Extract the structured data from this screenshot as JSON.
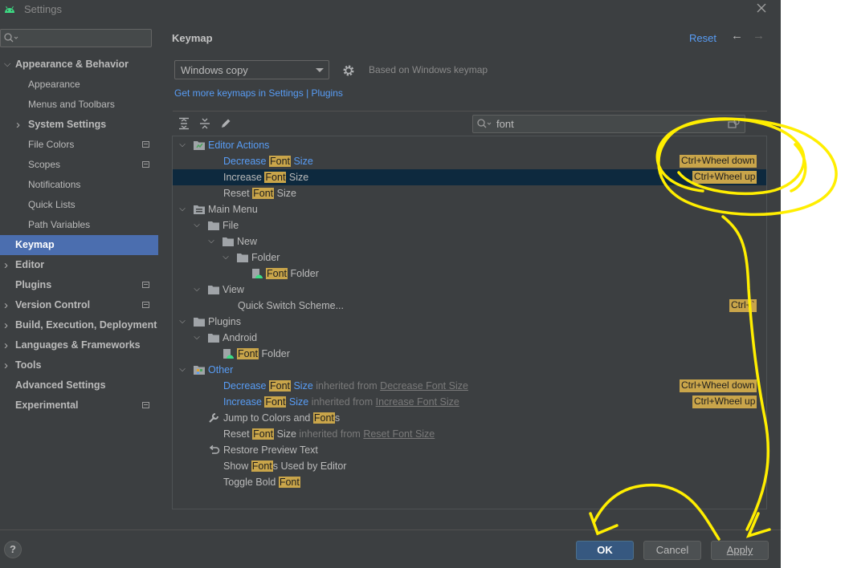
{
  "window": {
    "title": "Settings"
  },
  "search": {
    "placeholder": ""
  },
  "sidebar": {
    "items": [
      {
        "label": "Appearance & Behavior",
        "chevron": "expanded",
        "bold": true
      },
      {
        "label": "Appearance"
      },
      {
        "label": "Menus and Toolbars"
      },
      {
        "label": "System Settings",
        "chevron": "collapsed"
      },
      {
        "label": "File Colors",
        "project_icon": true
      },
      {
        "label": "Scopes",
        "project_icon": true
      },
      {
        "label": "Notifications"
      },
      {
        "label": "Quick Lists"
      },
      {
        "label": "Path Variables"
      },
      {
        "label": "Keymap",
        "selected": true
      },
      {
        "label": "Editor",
        "chevron": "collapsed"
      },
      {
        "label": "Plugins",
        "project_icon": true
      },
      {
        "label": "Version Control",
        "chevron": "collapsed",
        "project_icon": true
      },
      {
        "label": "Build, Execution, Deployment",
        "chevron": "collapsed"
      },
      {
        "label": "Languages & Frameworks",
        "chevron": "collapsed"
      },
      {
        "label": "Tools",
        "chevron": "collapsed"
      },
      {
        "label": "Advanced Settings"
      },
      {
        "label": "Experimental",
        "project_icon": true
      }
    ]
  },
  "header": {
    "title": "Keymap",
    "reset_label": "Reset"
  },
  "keymap": {
    "selected": "Windows copy",
    "based_on": "Based on Windows keymap",
    "get_more": "Get more keymaps in Settings | Plugins"
  },
  "filter": {
    "value": "font"
  },
  "tree": {
    "rows": [
      {
        "depth": 0,
        "chev": "down",
        "icon": "editor-actions",
        "parts": [
          {
            "t": "Editor Actions",
            "c": "blue"
          }
        ]
      },
      {
        "depth": 2,
        "parts": [
          {
            "t": "Decrease ",
            "c": "blue"
          },
          {
            "t": "Font",
            "c": "hl"
          },
          {
            "t": " Size",
            "c": "blue"
          }
        ],
        "shortcut": "Ctrl+Wheel down"
      },
      {
        "depth": 2,
        "selected": true,
        "parts": [
          {
            "t": "Increase "
          },
          {
            "t": "Font",
            "c": "hl"
          },
          {
            "t": " Size"
          }
        ],
        "shortcut": "Ctrl+Wheel up"
      },
      {
        "depth": 2,
        "parts": [
          {
            "t": "Reset "
          },
          {
            "t": "Font",
            "c": "hl"
          },
          {
            "t": " Size"
          }
        ]
      },
      {
        "depth": 0,
        "chev": "down",
        "icon": "main-menu",
        "parts": [
          {
            "t": "Main Menu"
          }
        ]
      },
      {
        "depth": 1,
        "chev": "down",
        "icon": "folder",
        "parts": [
          {
            "t": "File"
          }
        ]
      },
      {
        "depth": 2,
        "chev": "down",
        "icon": "folder",
        "parts": [
          {
            "t": "New"
          }
        ]
      },
      {
        "depth": 3,
        "chev": "down",
        "icon": "folder",
        "parts": [
          {
            "t": "Folder"
          }
        ]
      },
      {
        "depth": 4,
        "icon": "android-folder",
        "parts": [
          {
            "t": "Font",
            "c": "hl"
          },
          {
            "t": " Folder"
          }
        ]
      },
      {
        "depth": 1,
        "chev": "down",
        "icon": "folder",
        "parts": [
          {
            "t": "View"
          }
        ]
      },
      {
        "depth": 3,
        "parts": [
          {
            "t": "Quick Switch Scheme..."
          }
        ],
        "shortcut": "Ctrl+`"
      },
      {
        "depth": 0,
        "chev": "down",
        "icon": "folder",
        "parts": [
          {
            "t": "Plugins"
          }
        ]
      },
      {
        "depth": 1,
        "chev": "down",
        "icon": "folder",
        "parts": [
          {
            "t": "Android"
          }
        ]
      },
      {
        "depth": 2,
        "icon": "android-folder",
        "parts": [
          {
            "t": "Font",
            "c": "hl"
          },
          {
            "t": " Folder"
          }
        ]
      },
      {
        "depth": 0,
        "chev": "down",
        "icon": "other",
        "parts": [
          {
            "t": "Other",
            "c": "blue"
          }
        ]
      },
      {
        "depth": 2,
        "parts": [
          {
            "t": "Decrease ",
            "c": "blue"
          },
          {
            "t": "Font",
            "c": "hl"
          },
          {
            "t": " Size",
            "c": "blue"
          },
          {
            "t": " inherited from ",
            "c": "grey"
          },
          {
            "t": "Decrease Font Size",
            "c": "grey uline"
          }
        ],
        "shortcut": "Ctrl+Wheel down"
      },
      {
        "depth": 2,
        "parts": [
          {
            "t": "Increase ",
            "c": "blue"
          },
          {
            "t": "Font",
            "c": "hl"
          },
          {
            "t": " Size",
            "c": "blue"
          },
          {
            "t": " inherited from ",
            "c": "grey"
          },
          {
            "t": "Increase Font Size",
            "c": "grey uline"
          }
        ],
        "shortcut": "Ctrl+Wheel up"
      },
      {
        "depth": 2,
        "icon": "wrench",
        "parts": [
          {
            "t": "Jump to Colors and "
          },
          {
            "t": "Font",
            "c": "hl"
          },
          {
            "t": "s"
          }
        ]
      },
      {
        "depth": 2,
        "parts": [
          {
            "t": "Reset "
          },
          {
            "t": "Font",
            "c": "hl"
          },
          {
            "t": " Size"
          },
          {
            "t": " inherited from ",
            "c": "grey"
          },
          {
            "t": "Reset Font Size",
            "c": "grey uline"
          }
        ]
      },
      {
        "depth": 2,
        "icon": "undo",
        "parts": [
          {
            "t": "Restore Preview Text"
          }
        ]
      },
      {
        "depth": 2,
        "parts": [
          {
            "t": "Show "
          },
          {
            "t": "Font",
            "c": "hl"
          },
          {
            "t": "s Used by Editor"
          }
        ]
      },
      {
        "depth": 2,
        "parts": [
          {
            "t": "Toggle Bold "
          },
          {
            "t": "Font",
            "c": "hl"
          }
        ]
      }
    ]
  },
  "footer": {
    "help": "?",
    "ok": "OK",
    "cancel": "Cancel",
    "apply": "Apply"
  },
  "colors": {
    "accent": "#4b6eaf",
    "link": "#589df6",
    "highlight": "#c9a54a",
    "annotation": "#ffee00"
  }
}
